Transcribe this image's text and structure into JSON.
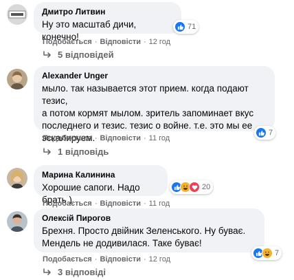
{
  "comments": [
    {
      "author": "Дмитро Литвин",
      "text": "Ну это масштаб дичи, конечно!",
      "reaction_count": "71",
      "reactions": [
        "like-icon"
      ],
      "like_label": "Подобається",
      "reply_label": "Відповісти",
      "time": "12 год",
      "replies_label": "5 відповідей"
    },
    {
      "author": "Alexander Unger",
      "text": "мыло. так называется этот прием. когда подают тезис,\nа потом кормят мылом. зритель запоминает вкус\nпоследнего и тезис. тезис о войне. т.е. это мы ее\nэскалируем.",
      "reaction_count": "7",
      "reactions": [
        "like-icon"
      ],
      "like_label": "Подобається",
      "reply_label": "Відповісти",
      "time": "11 год",
      "replies_label": "1 відповідь"
    },
    {
      "author": "Марина Калинина",
      "text": "Хорошие сапоги. Надо брать )",
      "reaction_count": "20",
      "reactions": [
        "like-icon",
        "haha-icon",
        "love-icon"
      ],
      "like_label": "Подобається",
      "reply_label": "Відповісти",
      "time": "11 год"
    },
    {
      "author": "Олексій Пирогов",
      "text": "Брехня. Просто двійник Зеленського. Ну буває.\nМендель не додивилася. Таке буває!",
      "reaction_count": "7",
      "reactions": [
        "like-icon",
        "haha-icon"
      ],
      "like_label": "Подобається",
      "reply_label": "Відповісти",
      "time": "12 год",
      "replies_label": "3 відповіді"
    }
  ],
  "colors": {
    "bubble": "#f0f2f5",
    "meta_text": "#65676b",
    "like_blue": "#1877f2",
    "haha_yellow": "#f7b125",
    "love_red": "#f33e58"
  }
}
